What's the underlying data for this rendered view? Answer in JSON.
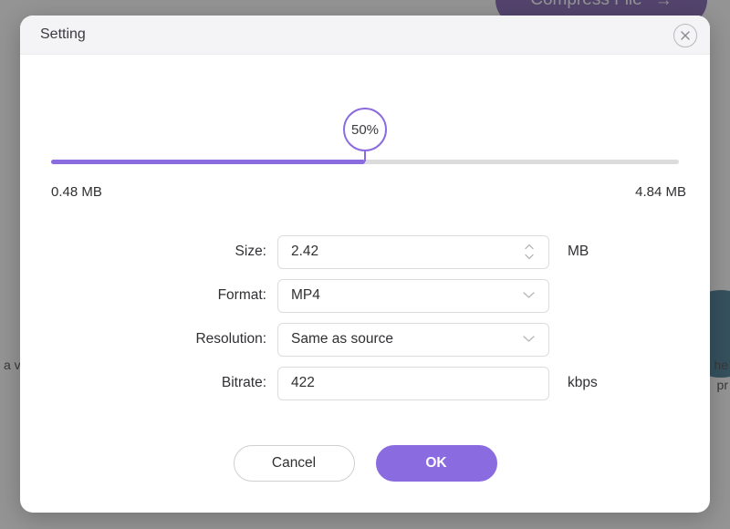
{
  "background": {
    "compress_button_label": "Compress File",
    "compress_button_arrow": "→",
    "text_left": "a v",
    "text_right": "he",
    "text_right_2": "pr"
  },
  "dialog": {
    "title": "Setting",
    "close_icon": "close-icon",
    "slider": {
      "value_label": "50%",
      "percent": 50,
      "min_label": "0.48 MB",
      "max_label": "4.84 MB",
      "fill_color": "#8B6BE0",
      "track_color": "#dcdcdc"
    },
    "fields": [
      {
        "label": "Size:",
        "value": "2.42",
        "unit": "MB",
        "control": "stepper",
        "icon": "stepper-icon"
      },
      {
        "label": "Format:",
        "value": "MP4",
        "unit": "",
        "control": "select",
        "icon": "chevron-down-icon"
      },
      {
        "label": "Resolution:",
        "value": "Same as source",
        "unit": "",
        "control": "select",
        "icon": "chevron-down-icon"
      },
      {
        "label": "Bitrate:",
        "value": "422",
        "unit": "kbps",
        "control": "text",
        "icon": ""
      }
    ],
    "buttons": {
      "cancel": "Cancel",
      "ok": "OK",
      "ok_color": "#8B6BE0"
    }
  }
}
